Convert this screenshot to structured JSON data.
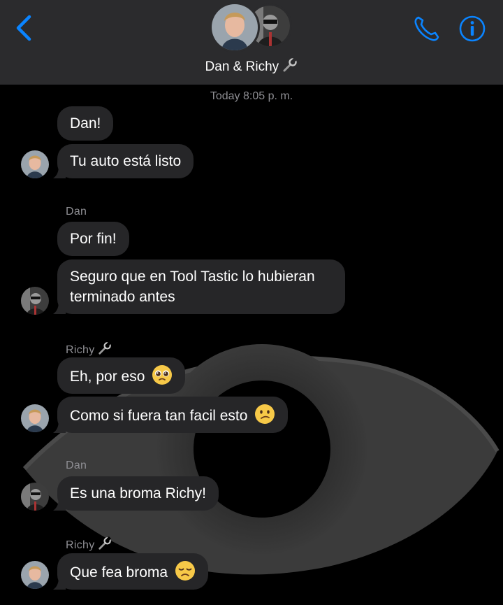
{
  "header": {
    "title": "Dan & Richy",
    "title_icon": "wrench-icon"
  },
  "timestamp": "Today 8:05 p. m.",
  "messages": [
    {
      "text": "Dan!",
      "sender": "Dan"
    },
    {
      "text": "Tu auto está listo",
      "sender": "Dan"
    },
    {
      "text": "Por fin!",
      "sender": "Richy"
    },
    {
      "text": "Seguro que en Tool Tastic lo hubieran terminado antes",
      "sender": "Richy"
    },
    {
      "text": "Eh, por eso",
      "emoji": "pleading-face-emoji",
      "sender": "Dan"
    },
    {
      "text": "Como si fuera tan facil esto",
      "emoji": "confused-face-emoji",
      "sender": "Dan"
    },
    {
      "text": "Es una broma Richy!",
      "sender": "Richy"
    },
    {
      "text": "Que fea broma",
      "emoji": "disappointed-face-emoji",
      "sender": "Dan"
    }
  ],
  "sender_labels": {
    "dan_1": "Dan",
    "richy_1": "Richy",
    "dan_2": "Dan",
    "richy_2": "Richy"
  },
  "colors": {
    "accent": "#0a84ff",
    "header_bg": "#2b2b2d",
    "bubble_bg": "#262628",
    "meta_text": "#8e8e93"
  }
}
